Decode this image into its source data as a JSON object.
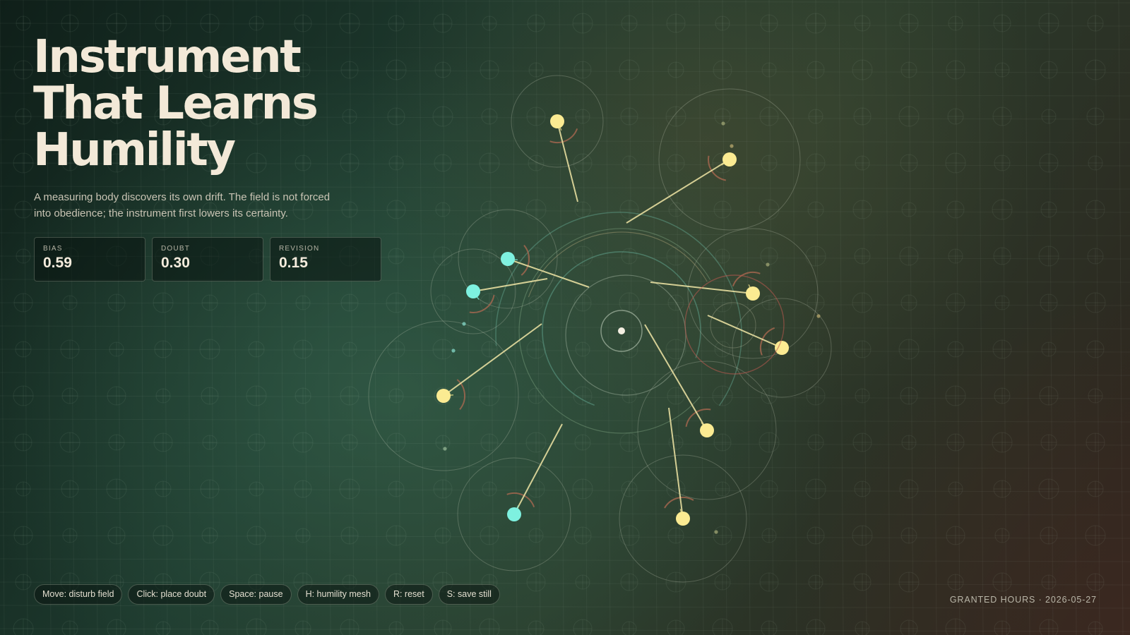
{
  "title": {
    "line1": "Instrument",
    "line2": "That Learns",
    "line3": "Humility"
  },
  "subtitle": "A measuring body discovers its own drift. The field is not forced into obedience; the instrument first lowers its certainty.",
  "metrics": [
    {
      "label": "BIAS",
      "value": "0.59"
    },
    {
      "label": "DOUBT",
      "value": "0.30"
    },
    {
      "label": "REVISION",
      "value": "0.15"
    }
  ],
  "controls": [
    "Move: disturb field",
    "Click: place doubt",
    "Space: pause",
    "H: humility mesh",
    "R: reset",
    "S: save still"
  ],
  "footer": "GRANTED HOURS · 2026-05-27",
  "colors": {
    "warm_probe": "#fbeb92",
    "cool_probe": "#7ef1e0",
    "tether": "#f1e6a6",
    "arc_warm": "#b06a52",
    "ring_teal": "#5fa08a"
  }
}
